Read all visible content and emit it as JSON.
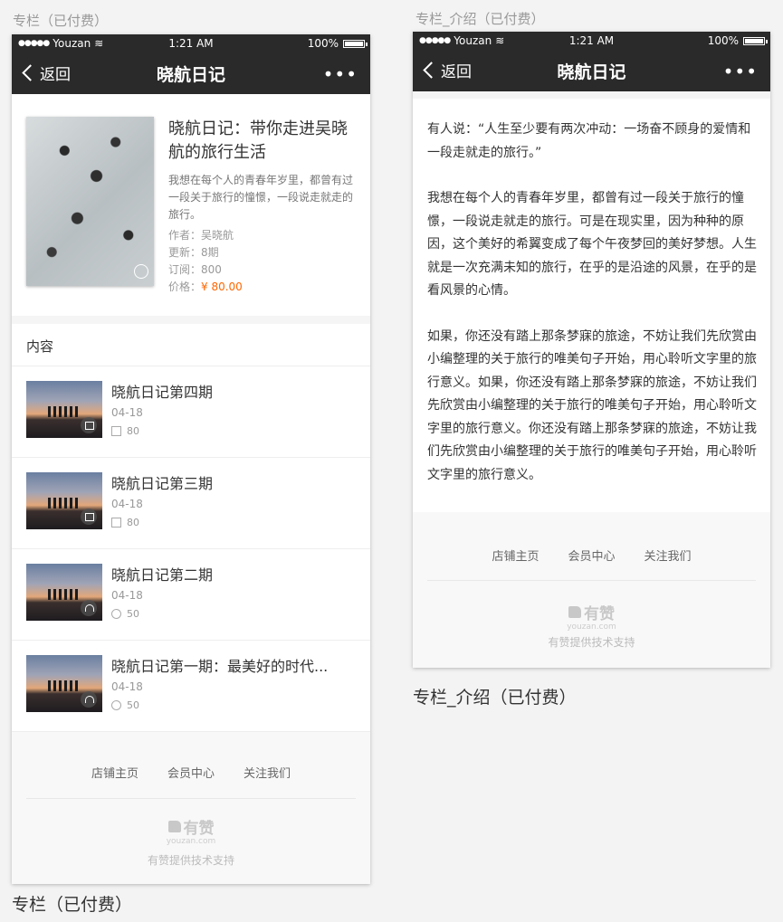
{
  "left_caption_top": "专栏（已付费）",
  "left_caption_bottom": "专栏（已付费）",
  "right_caption_top": "专栏_介绍（已付费）",
  "right_caption_bottom": "专栏_介绍（已付费）",
  "status": {
    "carrier": "Youzan",
    "time": "1:21 AM",
    "battery": "100%"
  },
  "nav": {
    "back": "返回",
    "title": "晓航日记",
    "more": "•••"
  },
  "column": {
    "title": "晓航日记：带你走进吴晓航的旅行生活",
    "desc": "我想在每个人的青春年岁里，都曾有过一段关于旅行的憧憬，一段说走就走的旅行。",
    "author": "作者：吴晓航",
    "updates": "更新：8期",
    "subscribers": "订阅：800",
    "price_label": "价格：",
    "price": "¥ 80.00"
  },
  "section_title": "内容",
  "items": [
    {
      "title": "晓航日记第四期",
      "date": "04-18",
      "count": "80",
      "type": "article"
    },
    {
      "title": "晓航日记第三期",
      "date": "04-18",
      "count": "80",
      "type": "article"
    },
    {
      "title": "晓航日记第二期",
      "date": "04-18",
      "count": "50",
      "type": "audio"
    },
    {
      "title": "晓航日记第一期：最美好的时代...",
      "date": "04-18",
      "count": "50",
      "type": "audio"
    }
  ],
  "footer": {
    "links": [
      "店铺主页",
      "会员中心",
      "关注我们"
    ],
    "brand": "有赞",
    "domain": "youzan.com",
    "support": "有赞提供技术支持"
  },
  "article": {
    "paragraphs": [
      "有人说：“人生至少要有两次冲动：一场奋不顾身的爱情和一段走就走的旅行。”",
      "我想在每个人的青春年岁里，都曾有过一段关于旅行的憧憬，一段说走就走的旅行。可是在现实里，因为种种的原因，这个美好的希翼变成了每个午夜梦回的美好梦想。人生就是一次充满未知的旅行，在乎的是沿途的风景，在乎的是看风景的心情。",
      "如果，你还没有踏上那条梦寐的旅途，不妨让我们先欣赏由小编整理的关于旅行的唯美句子开始，用心聆听文字里的旅行意义。如果，你还没有踏上那条梦寐的旅途，不妨让我们先欣赏由小编整理的关于旅行的唯美句子开始，用心聆听文字里的旅行意义。你还没有踏上那条梦寐的旅途，不妨让我们先欣赏由小编整理的关于旅行的唯美句子开始，用心聆听文字里的旅行意义。"
    ]
  }
}
